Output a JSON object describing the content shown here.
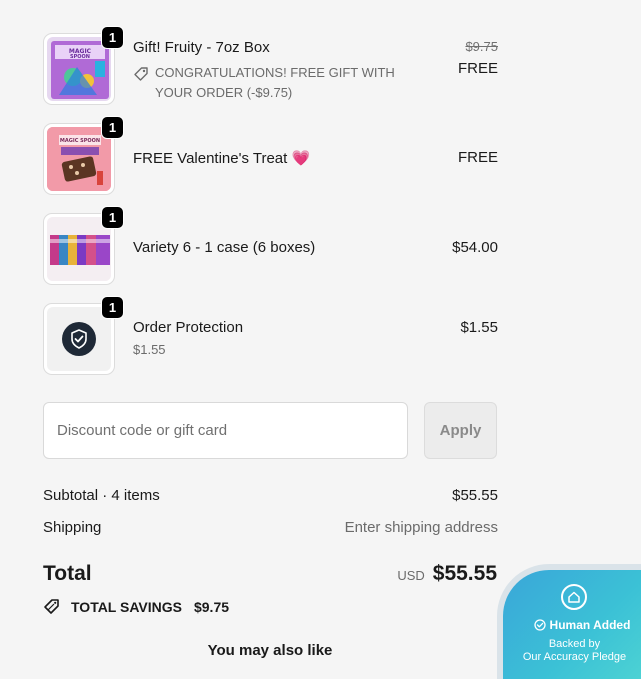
{
  "items": [
    {
      "quantity": "1",
      "title": "Gift! Fruity - 7oz Box",
      "discount_text": "CONGRATULATIONS! FREE GIFT WITH YOUR ORDER (-$9.75)",
      "original_price": "$9.75",
      "price": "FREE",
      "image_icon": "fruity-cereal-box"
    },
    {
      "quantity": "1",
      "title": "FREE Valentine's Treat 💗",
      "price": "FREE",
      "image_icon": "valentine-treat-bar"
    },
    {
      "quantity": "1",
      "title": "Variety 6 - 1 case (6 boxes)",
      "price": "$54.00",
      "image_icon": "variety-boxes"
    },
    {
      "quantity": "1",
      "title": "Order Protection",
      "subtitle": "$1.55",
      "price": "$1.55",
      "image_icon": "shield-check-icon"
    }
  ],
  "discount": {
    "placeholder": "Discount code or gift card",
    "apply_label": "Apply"
  },
  "summary": {
    "subtotal_label": "Subtotal · 4 items",
    "subtotal_value": "$55.55",
    "shipping_label": "Shipping",
    "shipping_value": "Enter shipping address",
    "total_label": "Total",
    "currency": "USD",
    "total_value": "$55.55",
    "savings_label": "TOTAL SAVINGS",
    "savings_value": "$9.75"
  },
  "recommendations_title": "You may also like",
  "pledge_badge": {
    "title": "Human Added",
    "subtitle_line1": "Backed by",
    "subtitle_line2": "Our Accuracy Pledge"
  },
  "colors": {
    "accent_badge": "#000000",
    "pledge_gradient_start": "#3aa6d9",
    "pledge_gradient_end": "#50d6d3",
    "protection_icon_bg": "#1f2937"
  }
}
